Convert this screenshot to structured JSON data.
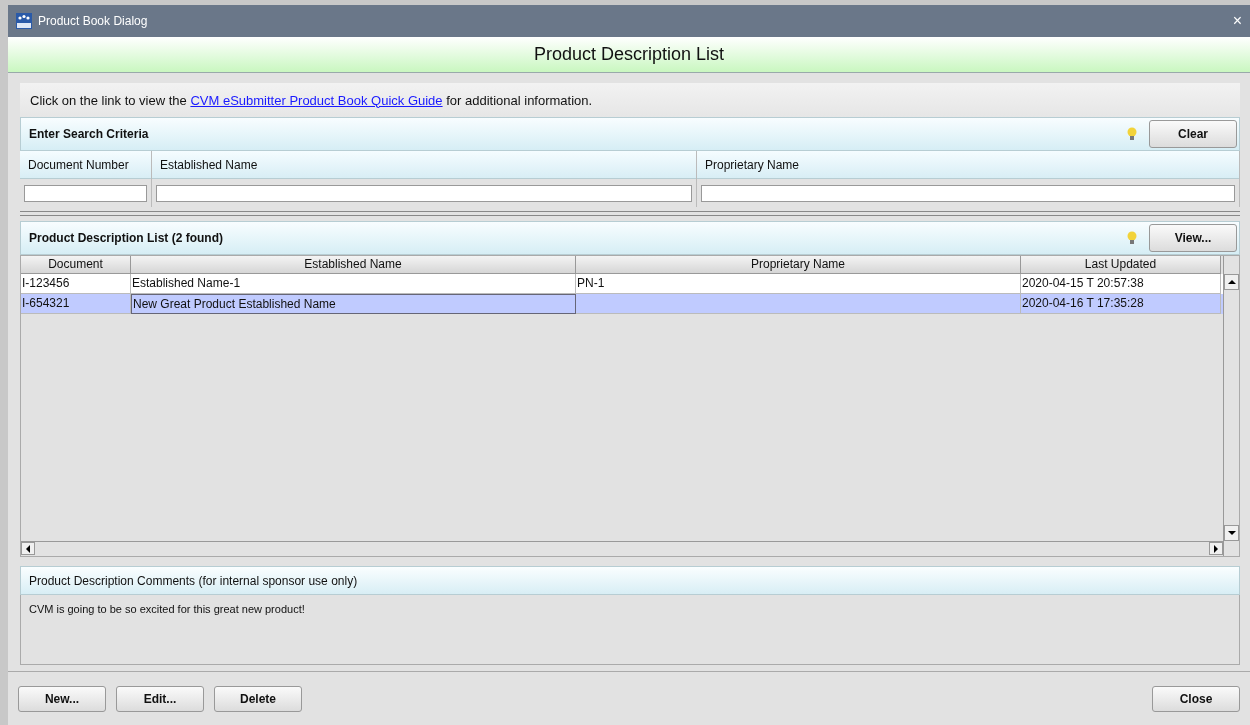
{
  "window": {
    "title": "Product Book Dialog",
    "close_glyph": "×"
  },
  "heading": "Product Description List",
  "info": {
    "before": "Click on the link to view the ",
    "link": "CVM eSubmitter Product Book Quick Guide",
    "after": " for additional information."
  },
  "search": {
    "title": "Enter Search Criteria",
    "button": "Clear",
    "fields": [
      {
        "label": "Document Number"
      },
      {
        "label": "Established Name"
      },
      {
        "label": "Proprietary Name"
      }
    ]
  },
  "list": {
    "title": "Product Description List  (2 found)",
    "button": "View...",
    "columns": [
      "Document",
      "Established Name",
      "Proprietary Name",
      "Last Updated"
    ],
    "rows": [
      {
        "cells": [
          "I-123456",
          "Established Name-1",
          "PN-1",
          "2020-04-15 T 20:57:38"
        ],
        "selected": false
      },
      {
        "cells": [
          "I-654321",
          "New Great Product Established Name",
          "",
          "2020-04-16 T 17:35:28"
        ],
        "selected": true
      }
    ]
  },
  "comments": {
    "title": "Product Description Comments (for internal sponsor use only)",
    "text": "CVM is going to be so excited for this great new product!"
  },
  "buttons": [
    "New...",
    "Edit...",
    "Delete"
  ],
  "close_button": "Close"
}
